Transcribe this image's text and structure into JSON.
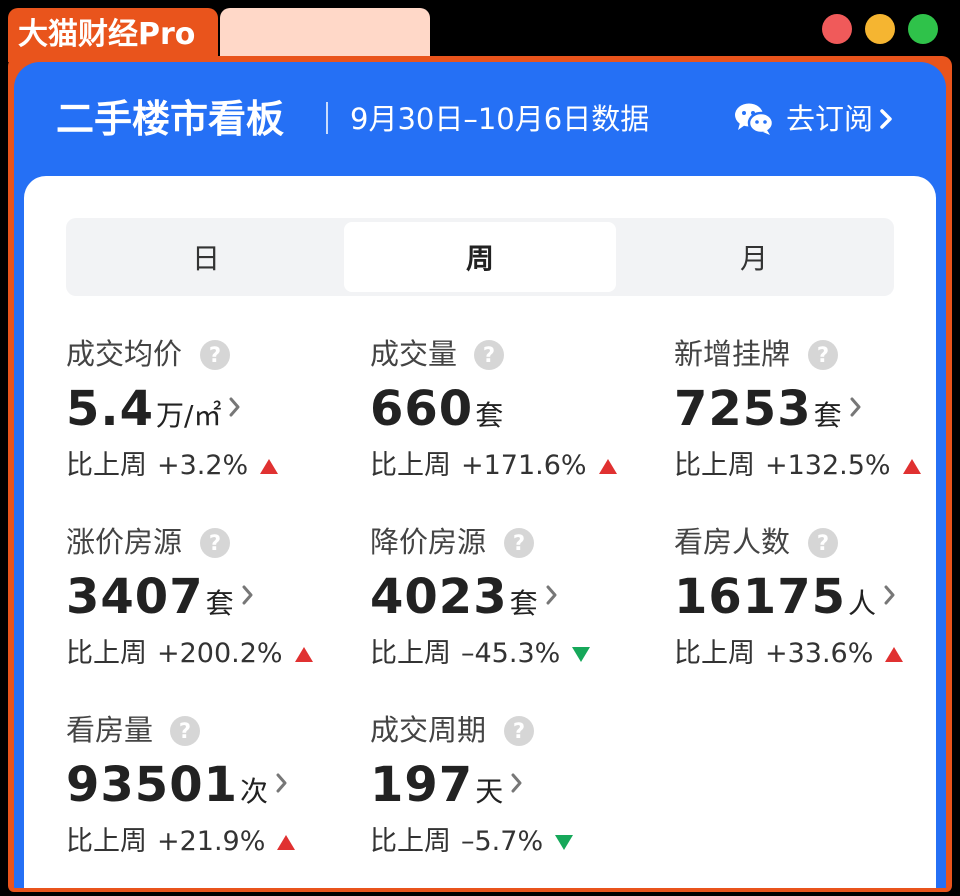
{
  "brand": {
    "name": "大猫财经Pro"
  },
  "header": {
    "title": "二手楼市看板",
    "date_range": "9月30日–10月6日数据",
    "subscribe_label": "去订阅",
    "subscribe_icon": "wechat-icon"
  },
  "colors": {
    "brand_orange": "#e9541c",
    "header_blue": "#2570f5",
    "up_red": "#e03131",
    "down_green": "#16a85a"
  },
  "tabs": [
    {
      "label": "日",
      "selected": false
    },
    {
      "label": "周",
      "selected": true
    },
    {
      "label": "月",
      "selected": false
    }
  ],
  "metrics": [
    {
      "label": "成交均价",
      "value": "5.4",
      "unit": "万/㎡",
      "change_prefix": "比上周",
      "change": "+3.2%",
      "trend": "up"
    },
    {
      "label": "成交量",
      "value": "660",
      "unit": "套",
      "change_prefix": "比上周",
      "change": "+171.6%",
      "trend": "up"
    },
    {
      "label": "新增挂牌",
      "value": "7253",
      "unit": "套",
      "change_prefix": "比上周",
      "change": "+132.5%",
      "trend": "up"
    },
    {
      "label": "涨价房源",
      "value": "3407",
      "unit": "套",
      "change_prefix": "比上周",
      "change": "+200.2%",
      "trend": "up"
    },
    {
      "label": "降价房源",
      "value": "4023",
      "unit": "套",
      "change_prefix": "比上周",
      "change": "–45.3%",
      "trend": "down"
    },
    {
      "label": "看房人数",
      "value": "16175",
      "unit": "人",
      "change_prefix": "比上周",
      "change": "+33.6%",
      "trend": "up"
    },
    {
      "label": "看房量",
      "value": "93501",
      "unit": "次",
      "change_prefix": "比上周",
      "change": "+21.9%",
      "trend": "up"
    },
    {
      "label": "成交周期",
      "value": "197",
      "unit": "天",
      "change_prefix": "比上周",
      "change": "–5.7%",
      "trend": "down"
    }
  ]
}
